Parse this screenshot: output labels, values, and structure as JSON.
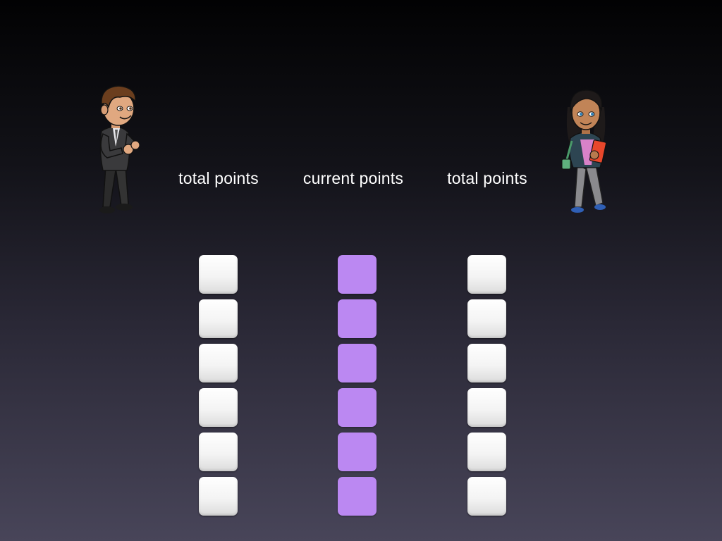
{
  "labels": {
    "left": "total points",
    "middle": "current points",
    "right": "total points"
  },
  "characters": {
    "left": "man-in-suit",
    "right": "woman-with-book"
  },
  "columns": {
    "left": {
      "tile_count": 6,
      "color": "#f2f2f2"
    },
    "middle": {
      "tile_count": 6,
      "color": "#bb88f2"
    },
    "right": {
      "tile_count": 6,
      "color": "#f2f2f2"
    }
  },
  "colors": {
    "background_top": "#020203",
    "background_bottom": "#484559",
    "label_text": "#ffffff",
    "tile_white": "#f2f2f2",
    "tile_purple": "#bb88f2"
  }
}
